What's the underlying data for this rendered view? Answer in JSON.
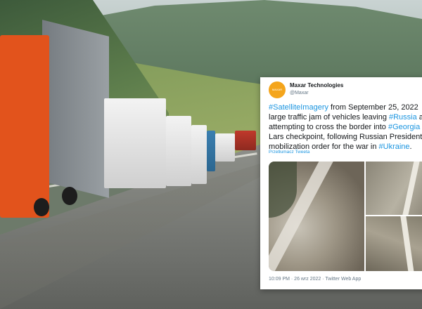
{
  "tweet": {
    "avatar_text": "MAXAR",
    "author_name": "Maxar Technologies",
    "author_handle": "@Maxar",
    "text_lines": [
      [
        {
          "t": "#SatelliteImagery",
          "tag": true
        },
        {
          "t": " from September 25, 2022",
          "tag": false
        }
      ],
      [
        {
          "t": "large traffic jam of vehicles leaving ",
          "tag": false
        },
        {
          "t": "#Russia",
          "tag": true
        },
        {
          "t": " a",
          "tag": false
        }
      ],
      [
        {
          "t": "attempting to cross the border into ",
          "tag": false
        },
        {
          "t": "#Georgia",
          "tag": true
        }
      ],
      [
        {
          "t": "Lars checkpoint, following Russian President",
          "tag": false
        }
      ],
      [
        {
          "t": "mobilization order for the war in ",
          "tag": false
        },
        {
          "t": "#Ukraine",
          "tag": true
        },
        {
          "t": ".",
          "tag": false
        }
      ]
    ],
    "translate_label": "Przetłumacz Tweeta",
    "timestamp": "10:09 PM · 26 wrz 2022 · Twitter Web App",
    "colors": {
      "link": "#1b95e0",
      "avatar": "#f4a51c"
    }
  }
}
